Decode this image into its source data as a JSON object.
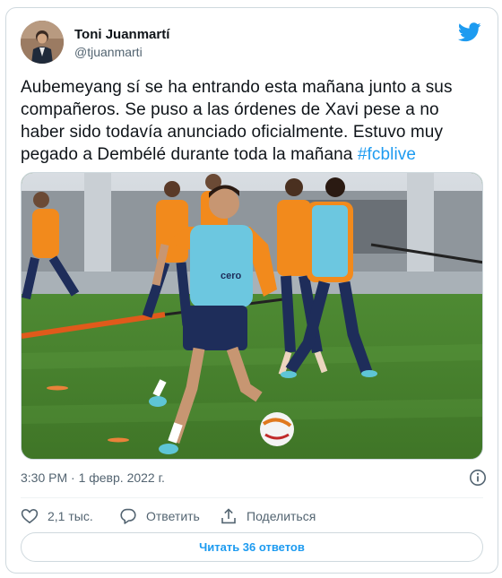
{
  "author": {
    "name": "Toni Juanmartí",
    "handle": "@tjuanmarti"
  },
  "tweet": {
    "text": "Aubemeyang sí se ha entrando esta mañana junto a sus compañeros. Se puso a las órdenes de Xavi pese a no haber sido todavía anunciado oficialmente. Estuvo muy pegado a Dembélé durante toda la mañana ",
    "hashtag": "#fcblive"
  },
  "timestamp": "3:30 PM · 1 февр. 2022 г.",
  "actions": {
    "like_count": "2,1 тыс.",
    "reply_label": "Ответить",
    "share_label": "Поделиться"
  },
  "read_replies_label": "Читать 36 ответов",
  "colors": {
    "accent": "#1d9bf0",
    "text_primary": "#0f1419",
    "text_secondary": "#536471",
    "border": "#cfd9de"
  },
  "icons": {
    "logo": "twitter-bird-icon",
    "info": "info-icon",
    "like": "heart-icon",
    "reply": "speech-bubble-icon",
    "share": "share-upload-icon"
  }
}
